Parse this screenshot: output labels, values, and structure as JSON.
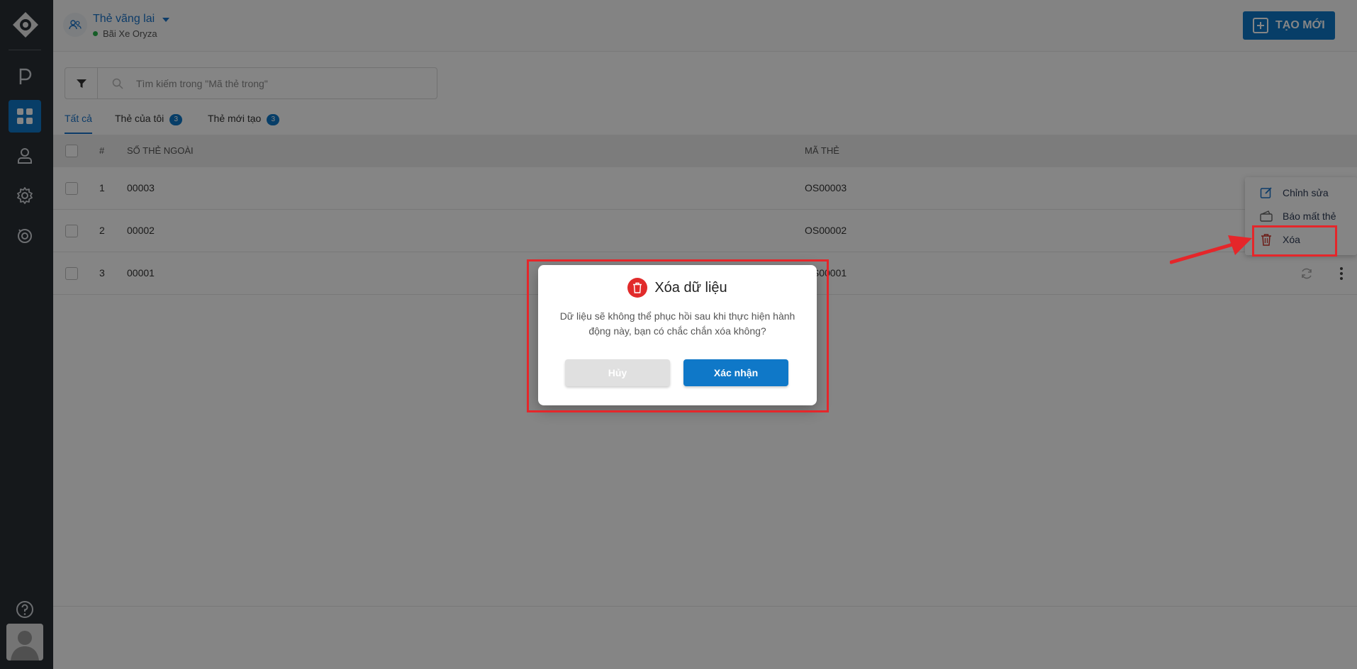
{
  "header": {
    "title": "Thẻ vãng lai",
    "subtitle": "Bãi Xe Oryza",
    "new_button": "TẠO MỚI"
  },
  "search": {
    "placeholder": "Tìm kiếm trong \"Mã thẻ trong\""
  },
  "tabs": [
    {
      "label": "Tất cả",
      "count": null
    },
    {
      "label": "Thẻ của tôi",
      "count": "3"
    },
    {
      "label": "Thẻ mới tạo",
      "count": "3"
    }
  ],
  "table": {
    "columns": [
      "#",
      "SỐ THẺ NGOÀI",
      "MÃ THẺ"
    ],
    "rows": [
      {
        "idx": "1",
        "out": "00003",
        "code": "OS00003"
      },
      {
        "idx": "2",
        "out": "00002",
        "code": "OS00002"
      },
      {
        "idx": "3",
        "out": "00001",
        "code": "OS00001"
      }
    ]
  },
  "context_menu": {
    "items": [
      "Chỉnh sửa",
      "Báo mất thẻ",
      "Xóa"
    ]
  },
  "modal": {
    "title": "Xóa dữ liệu",
    "message": "Dữ liệu sẽ không thể phục hồi sau khi thực hiện hành động này, bạn có chắc chắn xóa không?",
    "cancel": "Hủy",
    "confirm": "Xác nhận"
  },
  "colors": {
    "accent": "#0f78c8",
    "sidebar": "#2a2e35",
    "danger": "#e12b2b",
    "annotation": "#e5262a"
  }
}
